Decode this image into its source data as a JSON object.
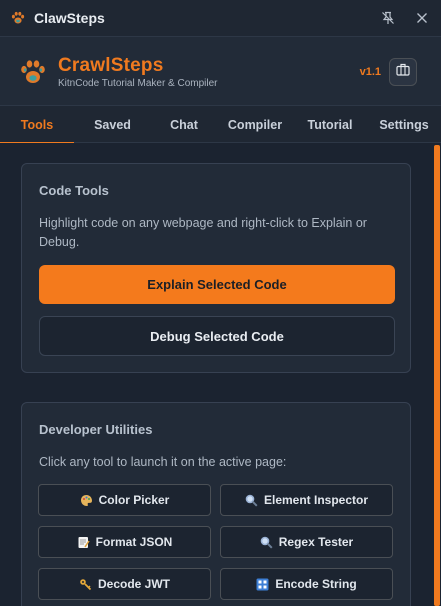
{
  "window": {
    "title": "ClawSteps"
  },
  "header": {
    "brand_name": "CrawlSteps",
    "brand_subtitle": "KitnCode Tutorial Maker & Compiler",
    "version": "v1.1"
  },
  "tabs": [
    {
      "label": "Tools",
      "active": true
    },
    {
      "label": "Saved",
      "active": false
    },
    {
      "label": "Chat",
      "active": false
    },
    {
      "label": "Compiler",
      "active": false
    },
    {
      "label": "Tutorial",
      "active": false
    },
    {
      "label": "Settings",
      "active": false
    }
  ],
  "code_tools": {
    "title": "Code Tools",
    "description": "Highlight code on any webpage and right-click to Explain or Debug.",
    "explain_label": "Explain Selected Code",
    "debug_label": "Debug Selected Code"
  },
  "dev_utils": {
    "title": "Developer Utilities",
    "description": "Click any tool to launch it on the active page:",
    "tools": [
      {
        "label": "Color Picker",
        "icon": "palette-icon"
      },
      {
        "label": "Element Inspector",
        "icon": "magnifier-icon"
      },
      {
        "label": "Format JSON",
        "icon": "memo-icon"
      },
      {
        "label": "Regex Tester",
        "icon": "magnifier-icon"
      },
      {
        "label": "Decode JWT",
        "icon": "key-icon"
      },
      {
        "label": "Encode String",
        "icon": "keypad-icon"
      }
    ]
  },
  "colors": {
    "accent": "#f07a1f",
    "background": "#1b2330",
    "card": "#222b38"
  }
}
